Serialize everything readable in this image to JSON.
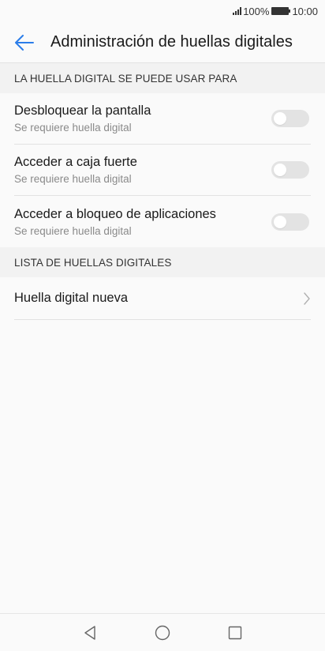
{
  "status_bar": {
    "battery": "100%",
    "time": "10:00"
  },
  "app_bar": {
    "title": "Administración de huellas digitales",
    "accent_color": "#2b7de9"
  },
  "section_usage": {
    "header": "LA HUELLA DIGITAL SE PUEDE USAR PARA",
    "items": [
      {
        "title": "Desbloquear la pantalla",
        "subtitle": "Se requiere huella digital",
        "enabled": false
      },
      {
        "title": "Acceder a caja fuerte",
        "subtitle": "Se requiere huella digital",
        "enabled": false
      },
      {
        "title": "Acceder a bloqueo de aplicaciones",
        "subtitle": "Se requiere huella digital",
        "enabled": false
      }
    ]
  },
  "section_list": {
    "header": "LISTA DE HUELLAS DIGITALES",
    "items": [
      {
        "title": "Huella digital nueva",
        "icon": "chevron-right-icon"
      }
    ]
  },
  "nav_bar": {
    "icons": [
      "back-triangle-icon",
      "home-circle-icon",
      "recents-square-icon"
    ]
  }
}
